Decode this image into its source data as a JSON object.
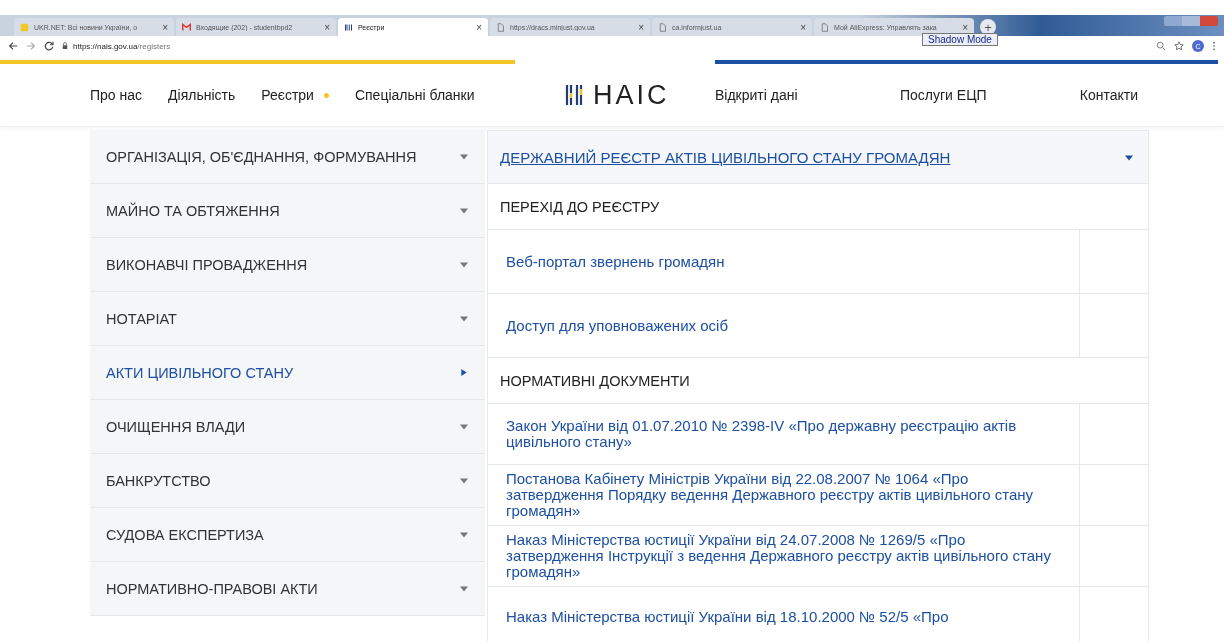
{
  "browser": {
    "tabs": [
      {
        "title": "UKR.NET: Всі новини України, о",
        "kind": "news",
        "selected": false,
        "close": "×"
      },
      {
        "title": "Входящие (202) - studentbpd2",
        "kind": "mail",
        "selected": false,
        "close": "×"
      },
      {
        "title": "Реєстри",
        "kind": "site",
        "selected": true,
        "close": "×"
      },
      {
        "title": "https://dracs.minjust.gov.ua",
        "kind": "page",
        "selected": false,
        "close": "×"
      },
      {
        "title": "ca.informjust.ua",
        "kind": "page",
        "selected": false,
        "close": "×"
      },
      {
        "title": "Мой AliExpress: Управлять зака",
        "kind": "page",
        "selected": false,
        "close": "×"
      }
    ],
    "new_tab": "+",
    "tooltip": "Shadow Mode",
    "address": {
      "host": "https://nais.gov.ua",
      "path": "/registers"
    },
    "profile": "C"
  },
  "nav": {
    "left": [
      {
        "label": "Про нас",
        "dot": false
      },
      {
        "label": "Діяльність",
        "dot": false
      },
      {
        "label": "Реєстри",
        "dot": true
      },
      {
        "label": "Спеціальні бланки",
        "dot": false
      }
    ],
    "logo": "НАІС",
    "right": [
      {
        "label": "Відкриті дані"
      },
      {
        "label": "Послуги ЕЦП"
      },
      {
        "label": "Контакти"
      }
    ]
  },
  "sidebar": [
    {
      "label": "ОРГАНІЗАЦІЯ, ОБ'ЄДНАННЯ, ФОРМУВАННЯ",
      "selected": false
    },
    {
      "label": "МАЙНО ТА ОБТЯЖЕННЯ",
      "selected": false
    },
    {
      "label": "ВИКОНАВЧІ ПРОВАДЖЕННЯ",
      "selected": false
    },
    {
      "label": "НОТАРІАТ",
      "selected": false
    },
    {
      "label": "АКТИ ЦИВІЛЬНОГО СТАНУ",
      "selected": true
    },
    {
      "label": "ОЧИЩЕННЯ ВЛАДИ",
      "selected": false
    },
    {
      "label": "БАНКРУТСТВО",
      "selected": false
    },
    {
      "label": "СУДОВА ЕКСПЕРТИЗА",
      "selected": false
    },
    {
      "label": "НОРМАТИВНО-ПРАВОВІ АКТИ",
      "selected": false
    }
  ],
  "panel": {
    "title": "ДЕРЖАВНИЙ РЕЄСТР АКТІВ ЦИВІЛЬНОГО СТАНУ ГРОМАДЯН",
    "expanded": true,
    "sections": [
      {
        "heading": "ПЕРЕХІД ДО РЕЄСТРУ",
        "links": [
          "Веб-портал звернень громадян",
          "Доступ для уповноважених осіб"
        ]
      },
      {
        "heading": "НОРМАТИВНІ ДОКУМЕНТИ",
        "links": [
          "Закон України від 01.07.2010 № 2398-IV «Про державну реєстрацію актів цивільного стану»",
          "Постанова Кабінету Міністрів України від 22.08.2007 № 1064 «Про затвердження Порядку ведення Державного реєстру актів цивільного стану громадян»",
          "Наказ Міністерства юстиції України від 24.07.2008 № 1269/5 «Про затвердження Інструкції з ведення Державного реєстру актів цивільного стану громадян»",
          "Наказ Міністерства юстиції України від 18.10.2000 № 52/5 «Про"
        ]
      }
    ]
  }
}
